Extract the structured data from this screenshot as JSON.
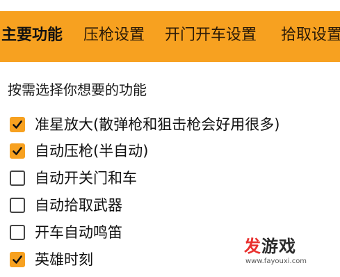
{
  "tabs": [
    {
      "label": "主要功能",
      "active": true
    },
    {
      "label": "压枪设置",
      "active": false
    },
    {
      "label": "开门开车设置",
      "active": false
    },
    {
      "label": "拾取设置",
      "active": false
    }
  ],
  "prompt": "按需选择你想要的功能",
  "options": [
    {
      "label": "准星放大(散弹枪和狙击枪会好用很多)",
      "checked": true
    },
    {
      "label": "自动压枪(半自动)",
      "checked": true
    },
    {
      "label": "自动开关门和车",
      "checked": false
    },
    {
      "label": "自动拾取武器",
      "checked": false
    },
    {
      "label": "开车自动鸣笛",
      "checked": false
    },
    {
      "label": "英雄时刻",
      "checked": true
    }
  ],
  "watermark": {
    "logo_part1": "发",
    "logo_part2": "游戏",
    "url": "www.fayouxi.com"
  },
  "colors": {
    "accent": "#f7a120",
    "text": "#111111"
  }
}
